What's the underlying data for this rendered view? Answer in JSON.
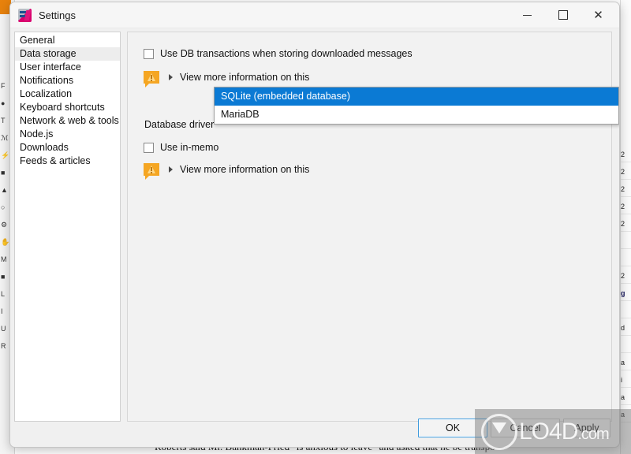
{
  "window": {
    "title": "Settings",
    "icon": "rss-guard-icon",
    "controls": {
      "minimize": "–",
      "maximize": "□",
      "close": "✕"
    }
  },
  "sidebar": {
    "items": [
      {
        "label": "General",
        "selected": false
      },
      {
        "label": "Data storage",
        "selected": true
      },
      {
        "label": "User interface",
        "selected": false
      },
      {
        "label": "Notifications",
        "selected": false
      },
      {
        "label": "Localization",
        "selected": false
      },
      {
        "label": "Keyboard shortcuts",
        "selected": false
      },
      {
        "label": "Network & web & tools",
        "selected": false
      },
      {
        "label": "Node.js",
        "selected": false
      },
      {
        "label": "Downloads",
        "selected": false
      },
      {
        "label": "Feeds & articles",
        "selected": false
      }
    ]
  },
  "pane": {
    "checkbox_db_transactions": {
      "label": "Use DB transactions when storing downloaded messages",
      "checked": false
    },
    "info_link_1": {
      "label": "View more information on this",
      "icon": "warning-bubble-icon"
    },
    "database_driver_label": "Database driver",
    "checkbox_in_memory": {
      "label": "Use in-memo",
      "checked": false
    },
    "info_link_2": {
      "label": "View more information on this",
      "icon": "warning-bubble-icon"
    }
  },
  "dropdown": {
    "open": true,
    "selected": "SQLite (embedded database)",
    "options": [
      {
        "label": "SQLite (embedded database)",
        "highlighted": true
      },
      {
        "label": "MariaDB",
        "highlighted": false
      }
    ]
  },
  "footer": {
    "ok": "OK",
    "cancel": "Cancel",
    "apply": "Apply"
  },
  "watermark": {
    "brand": "LO4D",
    "domain": ".com"
  },
  "background": {
    "article_text": "Roberts said Mr. Bankman-Fried \"is anxious to leave\" and asked that he be transpo",
    "left_rail": [
      "F",
      "●",
      "T",
      "ℳ",
      "⚡",
      "■",
      "▲",
      "○",
      "⚙",
      "✋",
      "M",
      "■",
      "L",
      "I",
      "U",
      "R"
    ],
    "right_rail": [
      "2",
      "2",
      "2",
      "2",
      "2",
      "",
      "",
      "2",
      "g",
      "",
      "d",
      "",
      "a",
      "i",
      "a",
      "a"
    ]
  },
  "colors": {
    "accent_blue": "#0b7ad4",
    "warning_orange": "#f5a623",
    "dialog_bg": "#f0f0f0",
    "focus_blue": "#3e9bdd"
  }
}
